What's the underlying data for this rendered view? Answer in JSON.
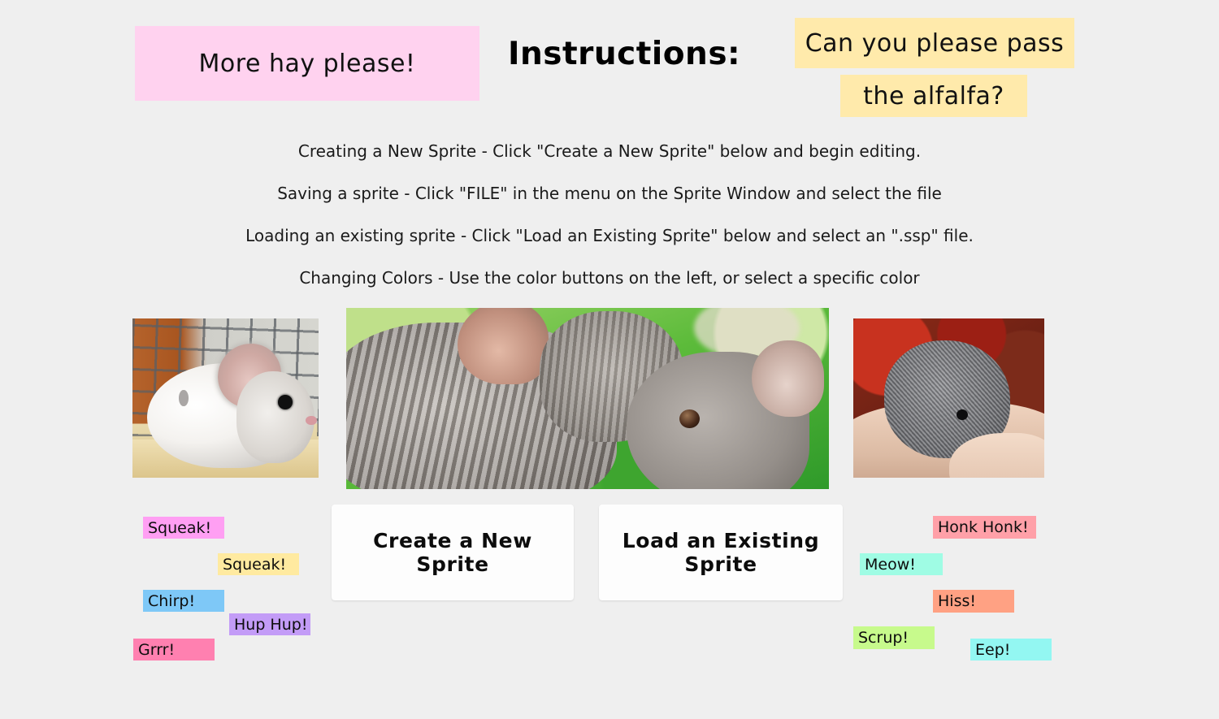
{
  "page": {
    "background_color": "#efefef",
    "heading": "Instructions:"
  },
  "notes": [
    {
      "id": "more-hay",
      "text": "More hay please!",
      "color": "#ffd2ef"
    },
    {
      "id": "pass-alfalfa-line1",
      "text": "Can you please pass",
      "color": "#ffeaab"
    },
    {
      "id": "pass-alfalfa-line2",
      "text": "the alfalfa?",
      "color": "#ffeaab"
    }
  ],
  "instructions": [
    "Creating a New Sprite - Click \"Create a New Sprite\" below and begin editing.",
    "Saving a sprite - Click \"FILE\" in the menu on the Sprite Window and select the file",
    "Loading an existing sprite - Click \"Load an Existing Sprite\" below and select an \".ssp\" file.",
    "Changing Colors - Use the color buttons on the left, or select a specific color"
  ],
  "photos": [
    {
      "id": "photo-white-chinchilla-in-cage",
      "alt": "White chinchilla sitting in a wire cage on a wooden shelf"
    },
    {
      "id": "photo-two-grey-chinchillas",
      "alt": "Two grey chinchillas nose to nose against a green background"
    },
    {
      "id": "photo-baby-chinchilla-in-hands",
      "alt": "Baby grey chinchilla held in hands with red autumn leaves behind"
    }
  ],
  "buttons": {
    "create": "Create a New Sprite",
    "load": "Load an Existing Sprite"
  },
  "sound_chips_left": [
    {
      "text": "Squeak!",
      "color": "#ff9ff3"
    },
    {
      "text": "Squeak!",
      "color": "#ffeaa0"
    },
    {
      "text": "Chirp!",
      "color": "#7ec8f7"
    },
    {
      "text": "Hup Hup!",
      "color": "#c39cf7"
    },
    {
      "text": "Grrr!",
      "color": "#ff80b0"
    }
  ],
  "sound_chips_right": [
    {
      "text": "Honk Honk!",
      "color": "#ffa0a8"
    },
    {
      "text": "Meow!",
      "color": "#9ffce4"
    },
    {
      "text": "Hiss!",
      "color": "#ffa183"
    },
    {
      "text": "Scrup!",
      "color": "#c7fa8c"
    },
    {
      "text": "Eep!",
      "color": "#93f7f2"
    }
  ]
}
